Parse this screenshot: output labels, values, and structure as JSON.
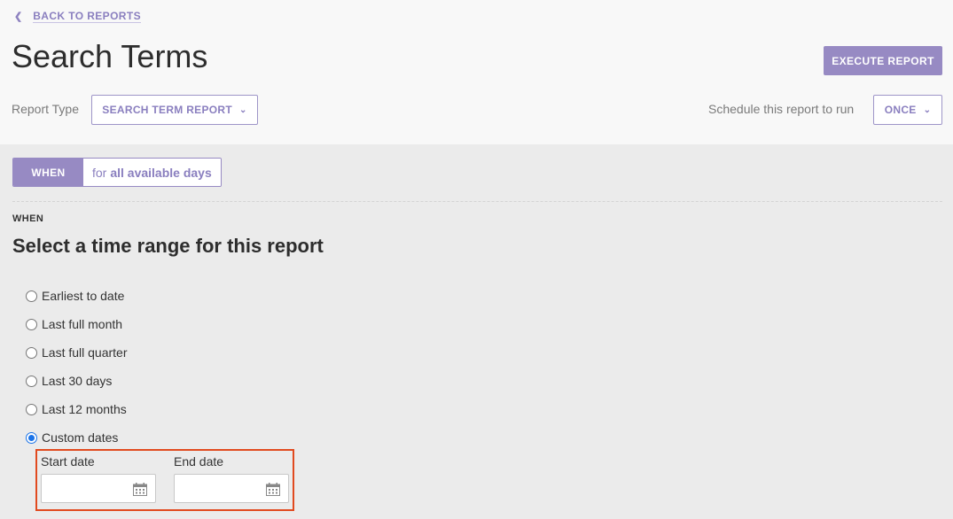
{
  "header": {
    "back_label": "BACK TO REPORTS",
    "title": "Search Terms",
    "execute_label": "EXECUTE REPORT"
  },
  "report_type": {
    "label": "Report Type",
    "value": "SEARCH TERM REPORT"
  },
  "schedule": {
    "label": "Schedule this report to run",
    "value": "ONCE"
  },
  "when_pill": {
    "tag": "WHEN",
    "prefix": "for",
    "value": "all available days"
  },
  "when_section": {
    "label": "WHEN",
    "heading": "Select a time range for this report",
    "options": [
      {
        "label": "Earliest to date",
        "checked": false
      },
      {
        "label": "Last full month",
        "checked": false
      },
      {
        "label": "Last full quarter",
        "checked": false
      },
      {
        "label": "Last 30 days",
        "checked": false
      },
      {
        "label": "Last 12 months",
        "checked": false
      },
      {
        "label": "Custom dates",
        "checked": true
      }
    ],
    "start_date": {
      "label": "Start date",
      "value": ""
    },
    "end_date": {
      "label": "End date",
      "value": ""
    }
  },
  "colors": {
    "accent": "#978ac3",
    "highlight_box": "#e14a1f",
    "radio_checked": "#1a73e8"
  }
}
